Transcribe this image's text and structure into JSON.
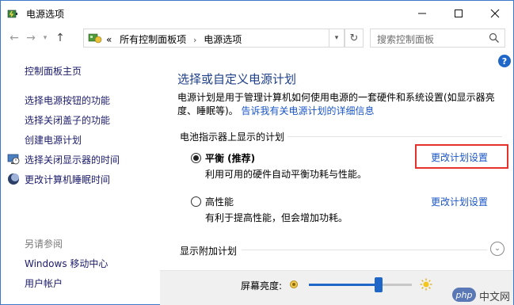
{
  "window": {
    "title": "电源选项",
    "minimize_glyph": "—",
    "maximize_glyph": "☐",
    "close_glyph": "✕"
  },
  "address": {
    "back_glyph": "←",
    "forward_glyph": "→",
    "recent_glyph": "▾",
    "up_glyph": "↑",
    "prefix": "«",
    "crumbs": [
      "所有控制面板项",
      "电源选项"
    ],
    "separator": "›",
    "dropdown_glyph": "▾",
    "refresh_glyph": "↻",
    "search_placeholder": "搜索控制面板",
    "icon": "control-panel-icon"
  },
  "help_glyph": "?",
  "sidebar": {
    "home": "控制面板主页",
    "items": [
      {
        "label": "选择电源按钮的功能",
        "icon": ""
      },
      {
        "label": "选择关闭盖子的功能",
        "icon": ""
      },
      {
        "label": "创建电源计划",
        "icon": ""
      },
      {
        "label": "选择关闭显示器的时间",
        "icon": "monitor-clock-icon"
      },
      {
        "label": "更改计算机睡眠时间",
        "icon": "moon-icon"
      }
    ],
    "see_also_title": "另请参阅",
    "see_also": [
      "Windows 移动中心",
      "用户帐户"
    ]
  },
  "main": {
    "title": "选择或自定义电源计划",
    "description": "电源计划是用于管理计算机如何使用电源的一套硬件和系统设置(如显示器亮度、睡眠等)。",
    "description_link": "告诉我有关电源计划的详细信息",
    "group_label": "电池指示器上显示的计划",
    "plans": [
      {
        "name": "平衡 (推荐)",
        "description": "利用可用的硬件自动平衡功耗与性能。",
        "selected": true,
        "change_link": "更改计划设置"
      },
      {
        "name": "高性能",
        "description": "有利于提高性能，但会增加功耗。",
        "selected": false,
        "change_link": "更改计划设置"
      }
    ],
    "show_more": "显示附加计划",
    "expand_glyph": "⌄"
  },
  "brightness": {
    "label": "屏幕亮度:",
    "level": 0.68
  },
  "watermark": {
    "badge": "php",
    "text": "中文网"
  },
  "colors": {
    "accent": "#1e66c8",
    "link": "#1a56c7",
    "title": "#1e3f8a",
    "highlight": "#e5322d"
  }
}
